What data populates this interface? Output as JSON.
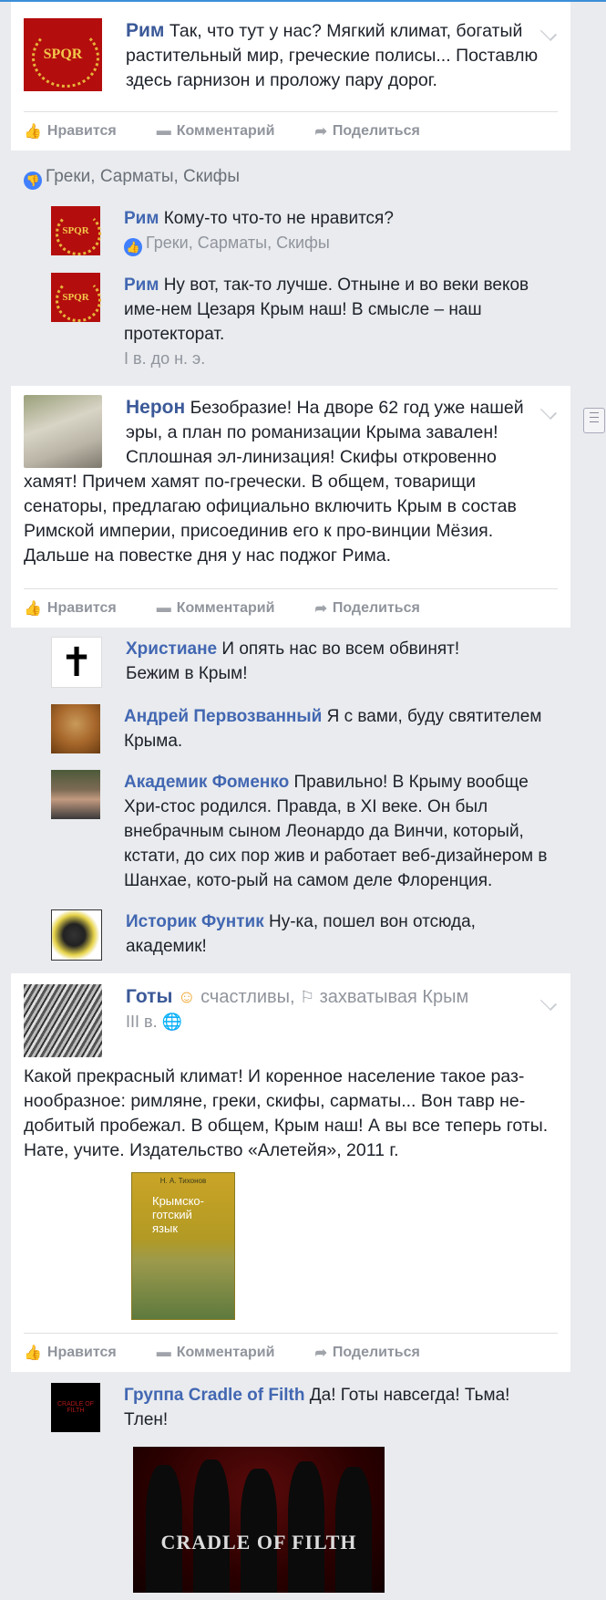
{
  "actions": {
    "like": "Нравится",
    "comment": "Комментарий",
    "share": "Поделиться"
  },
  "post1": {
    "author": "Рим",
    "avatar_text": "SPQR",
    "text": "Так, что тут у нас? Мягкий климат, богатый растительный мир, греческие полисы... Поставлю здесь гарнизон и проложу пару дорог."
  },
  "reaction1": "Греки, Сарматы, Скифы",
  "comments1": [
    {
      "author": "Рим",
      "text": "Кому-то что-то не нравится?",
      "likes": "Греки, Сарматы, Скифы"
    },
    {
      "author": "Рим",
      "text": "Ну вот, так-то лучше. Отныне и во веки веков име-нем Цезаря Крым наш! В смысле – наш протекторат.",
      "meta": "I в. до н. э."
    }
  ],
  "post2": {
    "author": "Нерон",
    "text": "Безобразие! На дворе 62 год уже нашей эры, а план по романизации Крыма завален! Сплошная эл-линизация! Скифы откровенно хамят! Причем хамят по-гречески. В общем, товарищи сенаторы, предлагаю официально включить Крым в состав Римской империи, присоединив его к про-винции Мёзия. Дальше на повестке дня у нас поджог Рима."
  },
  "comments2": [
    {
      "author": "Христиане",
      "text": "И опять нас во всем обвинят! Бежим в Крым!"
    },
    {
      "author": "Андрей Первозванный",
      "text": "Я с вами, буду святителем Крыма."
    },
    {
      "author": "Академик Фоменко",
      "text": "Правильно! В Крыму вообще Хри-стос родился. Правда, в XI веке. Он был внебрачным сыном Леонардо да Винчи, который, кстати, до сих пор жив и работает веб-дизайнером в Шанхае, кото-рый на самом деле Флоренция."
    },
    {
      "author": "Историк Фунтик",
      "text": "Ну-ка, пошел вон отсюда, академик!"
    }
  ],
  "post3": {
    "author": "Готы",
    "feeling": "счастливы,",
    "activity": "захватывая Крым",
    "meta": "III в.",
    "text": "Какой прекрасный климат! И коренное население такое раз-нообразное: римляне, греки, скифы, сарматы... Вон тавр не-добитый пробежал. В общем, Крым наш! А вы все теперь готы. Нате, учите. Издательство «Алетейя», 2011 г.",
    "book_author": "Н. А. Тихонов",
    "book_title": "Крымско-готский язык"
  },
  "comments3": [
    {
      "author": "Группа Cradle of Filth",
      "text": "Да! Готы навсегда! Тьма! Тлен!",
      "band_logo": "CRADLE OF FILTH"
    }
  ]
}
